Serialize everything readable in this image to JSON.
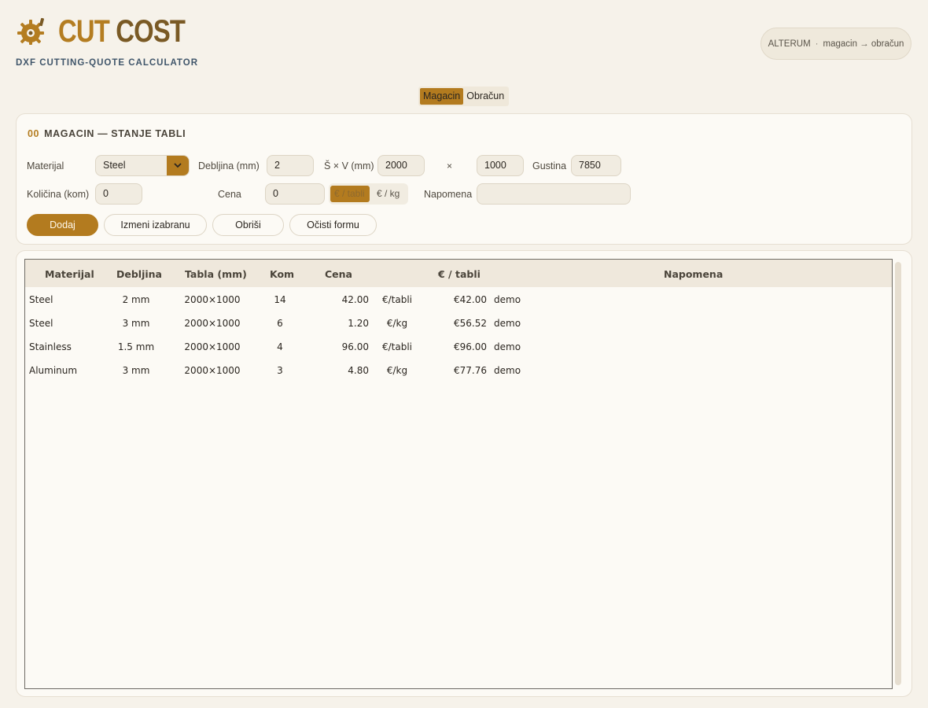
{
  "header": {
    "brand_word1": "CUT",
    "brand_word2": "COST",
    "subtitle": "DXF CUTTING-QUOTE CALCULATOR",
    "pill": {
      "left": "ALTERUM",
      "sep": "·",
      "right": "magacin → obračun"
    },
    "icon": "gear-icon"
  },
  "tabs": [
    {
      "label": "Magacin",
      "active": true
    },
    {
      "label": "Obračun",
      "active": false
    }
  ],
  "form": {
    "title_num": "00",
    "title": "MAGACIN — STANJE TABLI",
    "material_label": "Materijal",
    "material_value": "Steel",
    "thickness_label": "Debljina (mm)",
    "thickness_value": "2",
    "size_label": "Š × V (mm)",
    "width_value": "2000",
    "times": "×",
    "height_value": "1000",
    "density_label": "Gustina",
    "density_value": "7850",
    "qty_label": "Količina (kom)",
    "qty_value": "0",
    "price_label": "Cena",
    "price_value": "0",
    "unit_options": [
      "€ / tabli",
      "€ / kg"
    ],
    "note_label": "Napomena",
    "note_value": "",
    "buttons": {
      "add": "Dodaj",
      "edit": "Izmeni izabranu",
      "delete": "Obriši",
      "clear": "Očisti formu"
    }
  },
  "table": {
    "headers": [
      "Materijal",
      "Debljina",
      "Tabla (mm)",
      "Kom",
      "Cena",
      "€ / tabli",
      "Napomena"
    ],
    "rows": [
      {
        "material": "Steel",
        "thickness": "2 mm",
        "sheet": "2000×1000",
        "qty": "14",
        "price": "42.00",
        "unit": "€/tabli",
        "per_sheet": "€42.00",
        "note": "demo"
      },
      {
        "material": "Steel",
        "thickness": "3 mm",
        "sheet": "2000×1000",
        "qty": "6",
        "price": "1.20",
        "unit": "€/kg",
        "per_sheet": "€56.52",
        "note": "demo"
      },
      {
        "material": "Stainless",
        "thickness": "1.5 mm",
        "sheet": "2000×1000",
        "qty": "4",
        "price": "96.00",
        "unit": "€/tabli",
        "per_sheet": "€96.00",
        "note": "demo"
      },
      {
        "material": "Aluminum",
        "thickness": "3 mm",
        "sheet": "2000×1000",
        "qty": "3",
        "price": "4.80",
        "unit": "€/kg",
        "per_sheet": "€77.76",
        "note": "demo"
      }
    ]
  },
  "colors": {
    "accent": "#b37b1f",
    "background": "#f6f2ea",
    "card": "#fcfaf5"
  }
}
